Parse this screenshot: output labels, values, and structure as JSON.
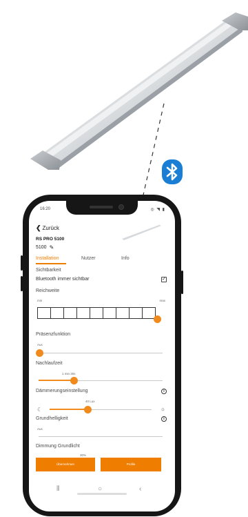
{
  "illustration": {
    "lamp_icon": "linear-led-fixture",
    "bluetooth_icon": "bluetooth-icon",
    "bluetooth_color": "#1a7fd4"
  },
  "status_bar": {
    "time": "16:20",
    "icons": "◎ ◥ ▮"
  },
  "header": {
    "back_label": "Zurück",
    "device_name": "RS PRO 5100",
    "device_id": "5100"
  },
  "tabs": [
    {
      "label": "Installation",
      "active": true
    },
    {
      "label": "Nutzer",
      "active": false
    },
    {
      "label": "Info",
      "active": false
    }
  ],
  "visibility": {
    "title": "Sichtbarkeit",
    "bluetooth_label": "Bluetooth immer sichtbar",
    "checked": true
  },
  "range": {
    "title": "Reichweite",
    "min_label": "min",
    "max_label": "max",
    "segments": 9,
    "level": 1.0
  },
  "presence": {
    "title": "Präsenzfunktion",
    "value_label": "Aus",
    "level": 0.0
  },
  "follow_up": {
    "title": "Nachlaufzeit",
    "value_label": "1 min 30s",
    "level": 0.3
  },
  "dusk": {
    "title": "Dämmerungseinstellung",
    "value_label": "40 Lux",
    "level": 0.35
  },
  "base_brightness": {
    "title": "Grundhelligkeit",
    "value_label": "Aus",
    "level": 0.0
  },
  "dimming": {
    "title": "Dimmung Grundlicht",
    "value_label": "30%"
  },
  "actions": {
    "apply_label": "Übernehmen",
    "profiles_label": "Profile"
  },
  "colors": {
    "accent": "#ef7d00",
    "frame": "#161616"
  }
}
